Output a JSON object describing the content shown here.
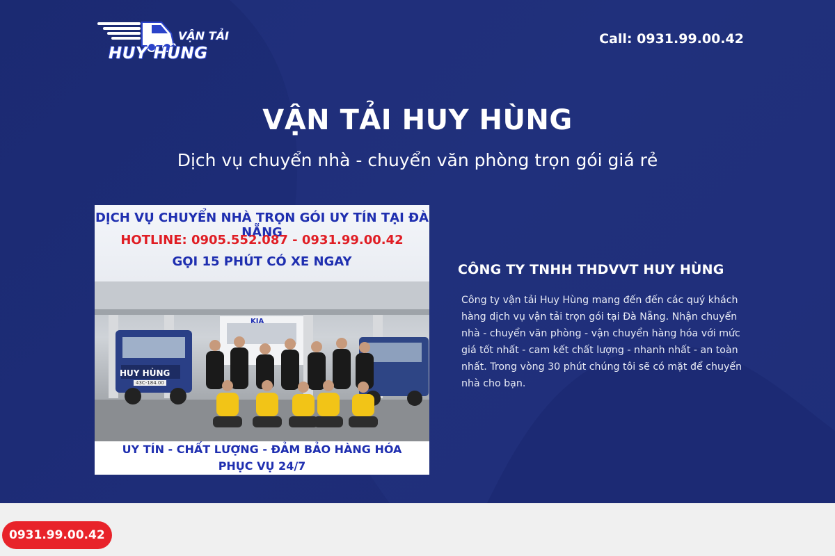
{
  "header": {
    "logo_text_top": "VẬN TẢI",
    "logo_text_bottom": "HUY HÙNG",
    "call": "Call: 0931.99.00.42"
  },
  "hero": {
    "title": "VẬN TẢI HUY HÙNG",
    "subtitle": "Dịch vụ chuyển nhà - chuyển văn phòng trọn gói giá rẻ"
  },
  "banner": {
    "line1": "DỊCH VỤ CHUYỂN NHÀ TRỌN GÓI UY TÍN TẠI ĐÀ NẴNG",
    "line2": "HOTLINE: 0905.552.087 - 0931.99.00.42",
    "line3": "GỌI 15 PHÚT CÓ XE NGAY",
    "truck_sign": "HUY HÙNG",
    "truck_brand": "KIA",
    "plate": "43C-184.00",
    "footer1": "UY TÍN - CHẤT LƯỢNG - ĐẢM BẢO HÀNG HÓA",
    "footer2": "PHỤC VỤ 24/7"
  },
  "about": {
    "title": "CÔNG TY TNHH THDVVT HUY HÙNG",
    "description": "Công ty vận tải Huy Hùng mang đến đến các quý khách hàng dịch vụ vận tải trọn gói tại Đà Nẵng. Nhận chuyển nhà - chuyển văn phòng  - vận chuyển hàng hóa với mức giá tốt nhất - cam kết chất lượng - nhanh nhất - an toàn nhất. Trong vòng 30 phút chúng tôi sẽ có mặt để chuyển nhà cho bạn."
  },
  "floating": {
    "phone": "0931.99.00.42"
  },
  "colors": {
    "hero_bg": "#1e2d78",
    "hotline_red": "#e01d24",
    "banner_blue": "#1f2fb0",
    "pill_red": "#e8232a",
    "uniform_yellow": "#f2c417"
  }
}
